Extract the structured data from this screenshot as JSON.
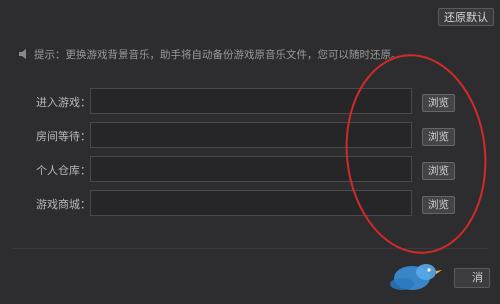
{
  "toolbar": {
    "restore_default_label": "还原默认"
  },
  "tip": {
    "text": "提示：更换游戏背景音乐，助手将自动备份游戏原音乐文件，您可以随时还原。"
  },
  "fields": [
    {
      "label": "进入游戏：",
      "value": "",
      "browse_label": "浏览"
    },
    {
      "label": "房间等待：",
      "value": "",
      "browse_label": "浏览"
    },
    {
      "label": "个人仓库：",
      "value": "",
      "browse_label": "浏览"
    },
    {
      "label": "游戏商城：",
      "value": "",
      "browse_label": "浏览"
    }
  ],
  "footer": {
    "button_partial_label": "消"
  },
  "colors": {
    "background": "#2d2d2f",
    "annotation": "#d22a2a",
    "watermark": "#3a8fd8"
  },
  "icons": {
    "tip": "speaker-icon",
    "watermark": "bird-logo-icon"
  }
}
